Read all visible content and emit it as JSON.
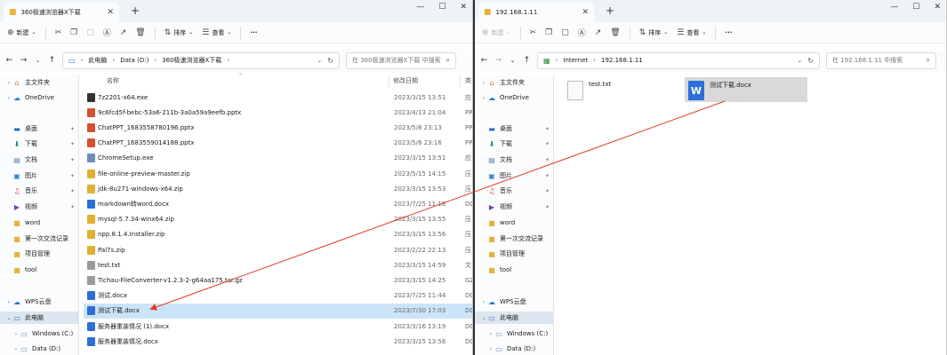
{
  "left_window": {
    "tab_title": "360极速浏览器X下载",
    "toolbar": {
      "new": "新建",
      "sort": "排序",
      "view": "查看",
      "more": "···"
    },
    "breadcrumbs": [
      "此电脑",
      "Data (D:)",
      "360极速浏览器X下载"
    ],
    "search_placeholder": "在 360极速浏览器X下载 中搜索",
    "columns": {
      "name": "名称",
      "date": "修改日期",
      "type": "类"
    },
    "files": [
      {
        "name": "7z2201-x64.exe",
        "date": "2023/3/15 13:51",
        "type": "应",
        "icon": "exe-7z",
        "color": "#333333"
      },
      {
        "name": "9c6fcd5f-bebc-53a6-211b-3a0a59a9eefb.pptx",
        "date": "2023/4/13 21:04",
        "type": "PP",
        "icon": "pptx",
        "color": "#d35230"
      },
      {
        "name": "ChatPPT_1683558780196.pptx",
        "date": "2023/5/8 23:13",
        "type": "PP",
        "icon": "pptx",
        "color": "#d35230"
      },
      {
        "name": "ChatPPT_1683559014188.pptx",
        "date": "2023/5/8 23:16",
        "type": "PP",
        "icon": "pptx",
        "color": "#d35230"
      },
      {
        "name": "ChromeSetup.exe",
        "date": "2023/3/15 13:51",
        "type": "应",
        "icon": "exe",
        "color": "#6b8fb8"
      },
      {
        "name": "file-online-preview-master.zip",
        "date": "2023/5/15 14:15",
        "type": "压",
        "icon": "zip",
        "color": "#e0b030"
      },
      {
        "name": "jdk-8u271-windows-x64.zip",
        "date": "2023/3/15 13:53",
        "type": "压",
        "icon": "zip",
        "color": "#e0b030"
      },
      {
        "name": "markdown转word.docx",
        "date": "2023/7/25 11:18",
        "type": "DC",
        "icon": "docx",
        "color": "#2b6fd8"
      },
      {
        "name": "mysql-5.7.34-winx64.zip",
        "date": "2023/3/15 13:55",
        "type": "压",
        "icon": "zip",
        "color": "#e0b030"
      },
      {
        "name": "npp.8.1.4.Installer.zip",
        "date": "2023/3/15 13:56",
        "type": "压",
        "icon": "zip",
        "color": "#e0b030"
      },
      {
        "name": "Pal7s.zip",
        "date": "2023/2/22 22:13",
        "type": "压",
        "icon": "zip",
        "color": "#e0b030"
      },
      {
        "name": "test.txt",
        "date": "2023/3/15 14:59",
        "type": "文",
        "icon": "txt",
        "color": "#9a9a9a"
      },
      {
        "name": "Tichau-FileConverter-v1.2.3-2-g64aa175.tar.gz",
        "date": "2023/3/15 14:25",
        "type": "GZ",
        "icon": "gz",
        "color": "#9a9a9a"
      },
      {
        "name": "测试.docx",
        "date": "2023/7/25 11:44",
        "type": "DC",
        "icon": "docx",
        "color": "#2b6fd8"
      },
      {
        "name": "测试下载.docx",
        "date": "2023/7/30 17:03",
        "type": "DC",
        "icon": "docx",
        "color": "#2b6fd8",
        "selected": true
      },
      {
        "name": "服务器重装情况 (1).docx",
        "date": "2023/3/16 13:19",
        "type": "DC",
        "icon": "docx",
        "color": "#2b6fd8"
      },
      {
        "name": "服务器重装情况.docx",
        "date": "2023/3/15 13:56",
        "type": "DC",
        "icon": "docx",
        "color": "#2b6fd8"
      }
    ]
  },
  "right_window": {
    "tab_title": "192.168.1.11",
    "toolbar": {
      "new": "新建",
      "sort": "排序",
      "view": "查看",
      "more": "···"
    },
    "breadcrumbs": [
      "Internet",
      "192.168.1.11"
    ],
    "search_placeholder": "在 192.168.1.11 中搜索",
    "files": [
      {
        "name": "test.txt",
        "icon": "txt"
      },
      {
        "name": "测试下载.docx",
        "icon": "docx",
        "selected": true
      }
    ]
  },
  "sidebar": {
    "items": [
      {
        "label": "主文件夹",
        "icon": "home-icon",
        "glyph": "⌂",
        "color": "#d07a2a",
        "pin": false,
        "expander": "›"
      },
      {
        "label": "OneDrive",
        "icon": "cloud-icon",
        "glyph": "☁",
        "color": "#1e78d8",
        "pin": false,
        "expander": "›"
      },
      {
        "label": "桌面",
        "icon": "desktop-icon",
        "glyph": "▬",
        "color": "#1f6fc1",
        "pin": true,
        "expander": ""
      },
      {
        "label": "下载",
        "icon": "download-icon",
        "glyph": "⬇",
        "color": "#1f8a4c",
        "pin": true,
        "expander": ""
      },
      {
        "label": "文档",
        "icon": "documents-icon",
        "glyph": "▤",
        "color": "#5b7ea8",
        "pin": true,
        "expander": ""
      },
      {
        "label": "图片",
        "icon": "pictures-icon",
        "glyph": "▣",
        "color": "#2d84c9",
        "pin": true,
        "expander": ""
      },
      {
        "label": "音乐",
        "icon": "music-icon",
        "glyph": "♫",
        "color": "#d24d2b",
        "pin": true,
        "expander": ""
      },
      {
        "label": "视频",
        "icon": "videos-icon",
        "glyph": "▶",
        "color": "#7a3fb0",
        "pin": true,
        "expander": ""
      },
      {
        "label": "word",
        "icon": "folder-icon",
        "glyph": "■",
        "color": "#e8b23a",
        "pin": false,
        "expander": ""
      },
      {
        "label": "第一次交流记录",
        "icon": "folder-icon",
        "glyph": "■",
        "color": "#e8b23a",
        "pin": false,
        "expander": ""
      },
      {
        "label": "项目管理",
        "icon": "folder-icon",
        "glyph": "■",
        "color": "#e8b23a",
        "pin": false,
        "expander": ""
      },
      {
        "label": "tool",
        "icon": "folder-icon",
        "glyph": "■",
        "color": "#e8b23a",
        "pin": false,
        "expander": ""
      },
      {
        "label": "WPS云盘",
        "icon": "wps-cloud-icon",
        "glyph": "☁",
        "color": "#1e78d8",
        "pin": false,
        "expander": "›"
      },
      {
        "label": "此电脑",
        "icon": "computer-icon",
        "glyph": "▭",
        "color": "#2d6fb8",
        "pin": false,
        "expander": "⌄",
        "selected": true
      },
      {
        "label": "Windows (C:)",
        "icon": "drive-icon",
        "glyph": "▭",
        "color": "#6b8fb8",
        "pin": false,
        "expander": "›",
        "indent": true
      },
      {
        "label": "Data (D:)",
        "icon": "drive-icon",
        "glyph": "▭",
        "color": "#6b8fb8",
        "pin": false,
        "expander": "›",
        "indent": true
      }
    ]
  },
  "drag_arrow": {
    "color": "#e03a2a"
  }
}
